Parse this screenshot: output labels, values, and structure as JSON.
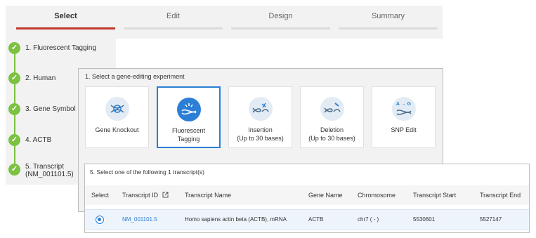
{
  "wizard": {
    "tabs": [
      {
        "label": "Select",
        "active": true
      },
      {
        "label": "Edit",
        "active": false
      },
      {
        "label": "Design",
        "active": false
      },
      {
        "label": "Summary",
        "active": false
      }
    ]
  },
  "steps": [
    {
      "label": "1. Fluorescent Tagging"
    },
    {
      "label": "2. Human"
    },
    {
      "label": "3. Gene Symbol"
    },
    {
      "label": "4. ACTB"
    },
    {
      "label": "5. Transcript",
      "sub": "(NM_001101.5)"
    }
  ],
  "experiment": {
    "title": "1. Select a gene-editing experiment",
    "options": [
      {
        "line1": "Gene Knockout",
        "line2": "",
        "icon": "gene-knockout-icon"
      },
      {
        "line1": "Fluorescent",
        "line2": "Tagging",
        "icon": "fluorescent-tagging-icon",
        "selected": true
      },
      {
        "line1": "Insertion",
        "line2": "(Up to 30 bases)",
        "icon": "insertion-icon"
      },
      {
        "line1": "Deletion",
        "line2": "(Up to 30 bases)",
        "icon": "deletion-icon"
      },
      {
        "line1": "SNP Edit",
        "line2": "",
        "icon": "snp-edit-icon",
        "icon_text": "A → G"
      }
    ]
  },
  "transcripts": {
    "title": "5. Select one of the following 1 transcript(s)",
    "columns": [
      "Select",
      "Transcript ID",
      "Transcript Name",
      "Gene Name",
      "Chromosome",
      "Transcript Start",
      "Transcript End"
    ],
    "rows": [
      {
        "id": "NM_001101.5",
        "name": "Homo sapiens actin beta (ACTB), mRNA",
        "gene": "ACTB",
        "chromosome": "chr7 ( - )",
        "start": "5530601",
        "end": "5527147",
        "selected": true
      }
    ]
  },
  "colors": {
    "accent": "#2b7fd6",
    "active_tab": "#c0392b",
    "check": "#7cc242"
  }
}
